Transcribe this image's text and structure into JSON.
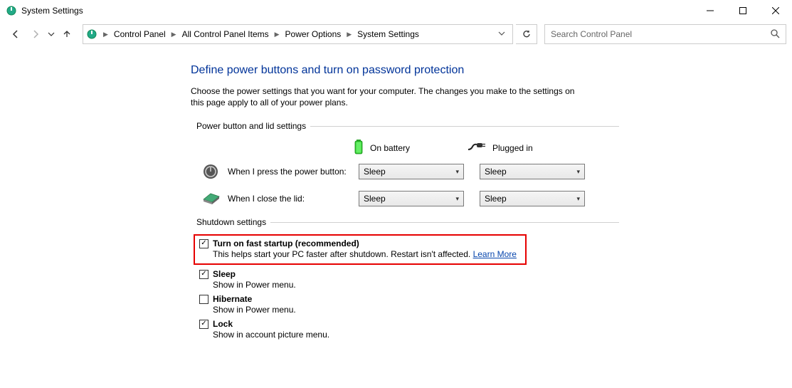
{
  "window": {
    "title": "System Settings"
  },
  "breadcrumbs": [
    "Control Panel",
    "All Control Panel Items",
    "Power Options",
    "System Settings"
  ],
  "search": {
    "placeholder": "Search Control Panel"
  },
  "page": {
    "title": "Define power buttons and turn on password protection",
    "description": "Choose the power settings that you want for your computer. The changes you make to the settings on this page apply to all of your power plans."
  },
  "sections": {
    "power_button": {
      "header": "Power button and lid settings",
      "columns": {
        "battery": "On battery",
        "plugged": "Plugged in"
      },
      "rows": [
        {
          "label": "When I press the power button:",
          "battery_value": "Sleep",
          "plugged_value": "Sleep"
        },
        {
          "label": "When I close the lid:",
          "battery_value": "Sleep",
          "plugged_value": "Sleep"
        }
      ]
    },
    "shutdown": {
      "header": "Shutdown settings",
      "items": [
        {
          "label": "Turn on fast startup (recommended)",
          "checked": true,
          "highlighted": true,
          "description_pre": "This helps start your PC faster after shutdown. Restart isn't affected. ",
          "link": "Learn More"
        },
        {
          "label": "Sleep",
          "checked": true,
          "description": "Show in Power menu."
        },
        {
          "label": "Hibernate",
          "checked": false,
          "description": "Show in Power menu."
        },
        {
          "label": "Lock",
          "checked": true,
          "description": "Show in account picture menu."
        }
      ]
    }
  }
}
